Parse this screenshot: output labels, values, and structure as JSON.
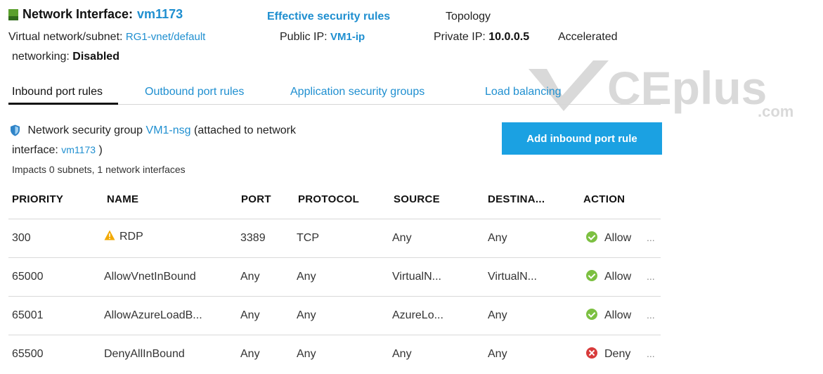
{
  "header": {
    "title_prefix": "Network Interface:",
    "nic_name": "vm1173",
    "vnet_label": "Virtual network/subnet:",
    "vnet_value": "RG1-vnet/default",
    "effective_rules_link": "Effective security rules",
    "public_ip_label": "Public IP:",
    "public_ip_value": "VM1-ip",
    "topology_link": "Topology",
    "private_ip_label": "Private IP:",
    "private_ip_value": "10.0.0.5",
    "accelerated_label": "Accelerated",
    "networking_label": "networking:",
    "networking_value": "Disabled"
  },
  "tabs": [
    {
      "label": "Inbound port rules",
      "active": true
    },
    {
      "label": "Outbound port rules",
      "active": false
    },
    {
      "label": "Application security groups",
      "active": false
    },
    {
      "label": "Load balancing",
      "active": false
    }
  ],
  "nsg": {
    "prefix": "Network security group",
    "name": "VM1-nsg",
    "attached_text": "(attached to network",
    "interface_label": "interface:",
    "interface_name": "vm1173",
    "close_paren": ")",
    "impacts": "Impacts 0 subnets, 1 network interfaces"
  },
  "add_button_label": "Add inbound port rule",
  "table": {
    "headers": [
      "PRIORITY",
      "NAME",
      "PORT",
      "PROTOCOL",
      "SOURCE",
      "DESTINA...",
      "ACTION"
    ],
    "rows": [
      {
        "priority": "300",
        "name": "RDP",
        "warning": true,
        "port": "3389",
        "protocol": "TCP",
        "source": "Any",
        "destination": "Any",
        "action": "Allow",
        "action_type": "allow",
        "more": "..."
      },
      {
        "priority": "65000",
        "name": "AllowVnetInBound",
        "warning": false,
        "port": "Any",
        "protocol": "Any",
        "source": "VirtualN...",
        "destination": "VirtualN...",
        "action": "Allow",
        "action_type": "allow",
        "more": "..."
      },
      {
        "priority": "65001",
        "name": "AllowAzureLoadB...",
        "warning": false,
        "port": "Any",
        "protocol": "Any",
        "source": "AzureLo...",
        "destination": "Any",
        "action": "Allow",
        "action_type": "allow",
        "more": "..."
      },
      {
        "priority": "65500",
        "name": "DenyAllInBound",
        "warning": false,
        "port": "Any",
        "protocol": "Any",
        "source": "Any",
        "destination": "Any",
        "action": "Deny",
        "action_type": "deny",
        "more": "..."
      }
    ]
  },
  "watermark": {
    "main": "CEplus",
    "sub": ".com"
  },
  "colors": {
    "accent": "#1ba1e2",
    "link": "#1f8fd0",
    "allow": "#7cc041",
    "deny": "#d83b3b",
    "warning": "#f2a900"
  }
}
